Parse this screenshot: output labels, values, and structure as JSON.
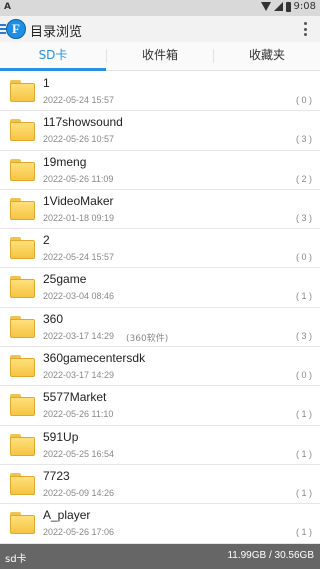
{
  "status_bar": {
    "left": "A",
    "time": "9:08"
  },
  "app_bar": {
    "logo_letter": "F",
    "title": "目录浏览"
  },
  "tabs": [
    {
      "label": "SD卡",
      "active": true
    },
    {
      "label": "收件箱",
      "active": false
    },
    {
      "label": "收藏夹",
      "active": false
    }
  ],
  "files": [
    {
      "name": "1",
      "date": "2022-05-24 15:57",
      "note": "",
      "count": "( 0 )"
    },
    {
      "name": "117showsound",
      "date": "2022-05-26 10:57",
      "note": "",
      "count": "( 3 )"
    },
    {
      "name": "19meng",
      "date": "2022-05-26 11:09",
      "note": "",
      "count": "( 2 )"
    },
    {
      "name": "1VideoMaker",
      "date": "2022-01-18 09:19",
      "note": "",
      "count": "( 3 )"
    },
    {
      "name": "2",
      "date": "2022-05-24 15:57",
      "note": "",
      "count": "( 0 )"
    },
    {
      "name": "25game",
      "date": "2022-03-04 08:46",
      "note": "",
      "count": "( 1 )"
    },
    {
      "name": "360",
      "date": "2022-03-17 14:29",
      "note": "(360软件)",
      "count": "( 3 )"
    },
    {
      "name": "360gamecentersdk",
      "date": "2022-03-17 14:29",
      "note": "",
      "count": "( 0 )"
    },
    {
      "name": "5577Market",
      "date": "2022-05-26 11:10",
      "note": "",
      "count": "( 1 )"
    },
    {
      "name": "591Up",
      "date": "2022-05-25 16:54",
      "note": "",
      "count": "( 1 )"
    },
    {
      "name": "7723",
      "date": "2022-05-09 14:26",
      "note": "",
      "count": "( 1 )"
    },
    {
      "name": "A_player",
      "date": "2022-05-26 17:06",
      "note": "",
      "count": "( 1 )"
    }
  ],
  "bottom_bar": {
    "left": "sd卡",
    "storage": "11.99GB / 30.56GB"
  },
  "colors": {
    "accent": "#2a90e0",
    "folder": "#f5c443",
    "bottom_bar": "#666666"
  }
}
